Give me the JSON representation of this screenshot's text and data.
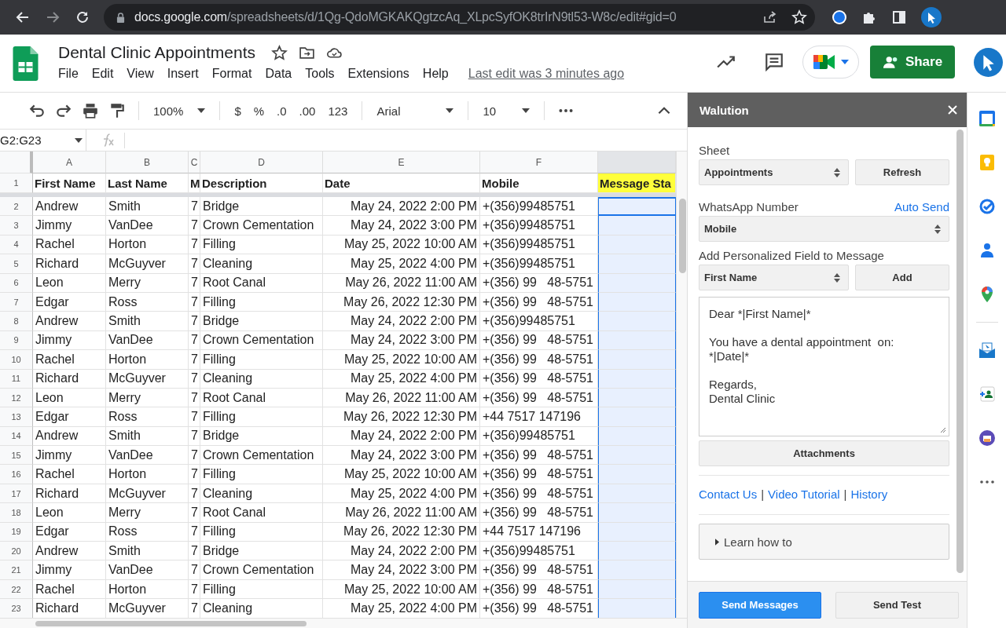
{
  "browser": {
    "url_host": "docs.google.com",
    "url_path": "/spreadsheets/d/1Qg-QdoMGKAKQgtzcAq_XLpcSyfOK8trIrN9tl53-W8c/edit#gid=0"
  },
  "document": {
    "title": "Dental Clinic Appointments",
    "menu": [
      "File",
      "Edit",
      "View",
      "Insert",
      "Format",
      "Data",
      "Tools",
      "Extensions",
      "Help"
    ],
    "last_edit": "Last edit was 3 minutes ago",
    "share": "Share"
  },
  "toolbar": {
    "zoom": "100%",
    "currency": "$",
    "percent": "%",
    "decrease_decimal": ".0",
    "increase_decimal": ".00",
    "number_format": "123",
    "font": "Arial",
    "font_size": "10"
  },
  "formula_bar": {
    "name_box": "G2:G23"
  },
  "sheet": {
    "columns": [
      {
        "letter": "A",
        "selected": false
      },
      {
        "letter": "B",
        "selected": false
      },
      {
        "letter": "C",
        "selected": false
      },
      {
        "letter": "D",
        "selected": false
      },
      {
        "letter": "E",
        "selected": false
      },
      {
        "letter": "F",
        "selected": false
      }
    ],
    "column_7": {
      "selected": true
    },
    "header_row": {
      "num": "1",
      "cells": [
        {
          "text": "First Name"
        },
        {
          "text": "Last Name"
        },
        {
          "text": "M"
        },
        {
          "text": "Description"
        },
        {
          "text": "Date"
        },
        {
          "text": "Mobile"
        },
        {
          "text": "Message Sta",
          "color": "#ffff3b"
        }
      ]
    },
    "rows": [
      {
        "num": "2",
        "cells": [
          "Andrew",
          "Smith",
          "7",
          "Bridge",
          "May 24, 2022 2:00 PM",
          "+(356)99485751"
        ]
      },
      {
        "num": "3",
        "cells": [
          "Jimmy",
          "VanDee",
          "7",
          "Crown Cementation",
          "May 24, 2022 3:00 PM",
          "+(356)99485751"
        ]
      },
      {
        "num": "4",
        "cells": [
          "Rachel",
          "Horton",
          "7",
          "Filling",
          "May 25, 2022 10:00 AM",
          "+(356)99485751"
        ]
      },
      {
        "num": "5",
        "cells": [
          "Richard",
          "McGuyver",
          "7",
          "Cleaning",
          "May 25, 2022 4:00 PM",
          "+(356)99485751"
        ]
      },
      {
        "num": "6",
        "cells": [
          "Leon",
          "Merry",
          "7",
          "Root Canal",
          "May 26, 2022 11:00 AM",
          "+(356) 99   48-5751"
        ]
      },
      {
        "num": "7",
        "cells": [
          "Edgar",
          "Ross",
          "7",
          "Filling",
          "May 26, 2022 12:30 PM",
          "+(356) 99   48-5751"
        ]
      },
      {
        "num": "8",
        "cells": [
          "Andrew",
          "Smith",
          "7",
          "Bridge",
          "May 24, 2022 2:00 PM",
          "+(356)99485751"
        ]
      },
      {
        "num": "9",
        "cells": [
          "Jimmy",
          "VanDee",
          "7",
          "Crown Cementation",
          "May 24, 2022 3:00 PM",
          "+(356) 99   48-5751"
        ]
      },
      {
        "num": "10",
        "cells": [
          "Rachel",
          "Horton",
          "7",
          "Filling",
          "May 25, 2022 10:00 AM",
          "+(356) 99   48-5751"
        ]
      },
      {
        "num": "11",
        "cells": [
          "Richard",
          "McGuyver",
          "7",
          "Cleaning",
          "May 25, 2022 4:00 PM",
          "+(356) 99   48-5751"
        ]
      },
      {
        "num": "12",
        "cells": [
          "Leon",
          "Merry",
          "7",
          "Root Canal",
          "May 26, 2022 11:00 AM",
          "+(356) 99   48-5751"
        ]
      },
      {
        "num": "13",
        "cells": [
          "Edgar",
          "Ross",
          "7",
          "Filling",
          "May 26, 2022 12:30 PM",
          "+44 7517 147196"
        ]
      },
      {
        "num": "14",
        "cells": [
          "Andrew",
          "Smith",
          "7",
          "Bridge",
          "May 24, 2022 2:00 PM",
          "+(356)99485751"
        ]
      },
      {
        "num": "15",
        "cells": [
          "Jimmy",
          "VanDee",
          "7",
          "Crown Cementation",
          "May 24, 2022 3:00 PM",
          "+(356) 99   48-5751"
        ]
      },
      {
        "num": "16",
        "cells": [
          "Rachel",
          "Horton",
          "7",
          "Filling",
          "May 25, 2022 10:00 AM",
          "+(356) 99   48-5751"
        ]
      },
      {
        "num": "17",
        "cells": [
          "Richard",
          "McGuyver",
          "7",
          "Cleaning",
          "May 25, 2022 4:00 PM",
          "+(356) 99   48-5751"
        ]
      },
      {
        "num": "18",
        "cells": [
          "Leon",
          "Merry",
          "7",
          "Root Canal",
          "May 26, 2022 11:00 AM",
          "+(356) 99   48-5751"
        ]
      },
      {
        "num": "19",
        "cells": [
          "Edgar",
          "Ross",
          "7",
          "Filling",
          "May 26, 2022 12:30 PM",
          "+44 7517 147196"
        ]
      },
      {
        "num": "20",
        "cells": [
          "Andrew",
          "Smith",
          "7",
          "Bridge",
          "May 24, 2022 2:00 PM",
          "+(356)99485751"
        ]
      },
      {
        "num": "21",
        "cells": [
          "Jimmy",
          "VanDee",
          "7",
          "Crown Cementation",
          "May 24, 2022 3:00 PM",
          "+(356) 99   48-5751"
        ]
      },
      {
        "num": "22",
        "cells": [
          "Rachel",
          "Horton",
          "7",
          "Filling",
          "May 25, 2022 10:00 AM",
          "+(356) 99   48-5751"
        ]
      },
      {
        "num": "23",
        "cells": [
          "Richard",
          "McGuyver",
          "7",
          "Cleaning",
          "May 25, 2022 4:00 PM",
          "+(356) 99   48-5751"
        ]
      }
    ]
  },
  "side_panel": {
    "title": "Walution",
    "sheet_label": "Sheet",
    "sheet_select": "Appointments",
    "refresh": "Refresh",
    "number_label": "WhatsApp Number",
    "auto_send": "Auto Send",
    "number_select": "Mobile",
    "field_label": "Add Personalized Field to Message",
    "field_select": "First Name",
    "add": "Add",
    "message": "Dear *|First Name|*\n\nYou have a dental appointment  on:\n*|Date|*\n\nRegards,\nDental Clinic",
    "attachments": "Attachments",
    "links": [
      {
        "kind": "link",
        "text": "Contact Us"
      },
      {
        "kind": "separator",
        "text": "|"
      },
      {
        "kind": "link",
        "text": "Video Tutorial"
      },
      {
        "kind": "separator",
        "text": "|"
      },
      {
        "kind": "link",
        "text": "History"
      }
    ],
    "learn": {
      "label": "Learn how to",
      "expanded": false
    },
    "send_messages": "Send Messages",
    "send_test": "Send Test"
  }
}
